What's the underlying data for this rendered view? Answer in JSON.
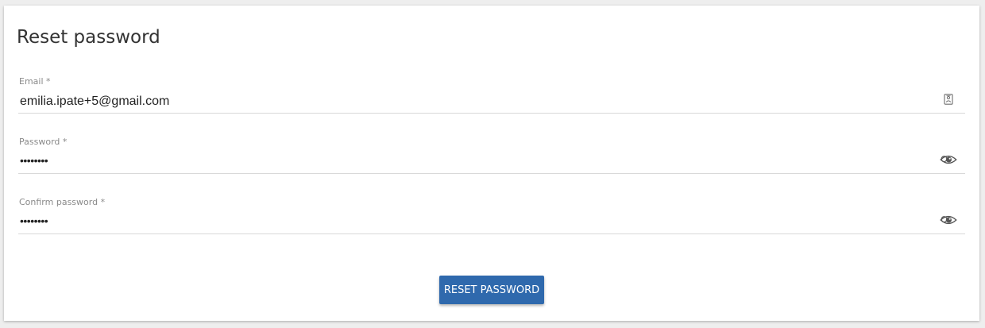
{
  "form": {
    "title": "Reset password",
    "fields": [
      {
        "label": "Email *",
        "value": "emilia.ipate+5@gmail.com",
        "icon": "contact-card-icon"
      },
      {
        "label": "Password *",
        "value": "••••••••",
        "icon": "eye-icon"
      },
      {
        "label": "Confirm password *",
        "value": "••••••••",
        "icon": "eye-icon"
      }
    ],
    "submit_label": "RESET PASSWORD"
  },
  "colors": {
    "button": "#2f69ad",
    "background": "#eeeeee",
    "card": "#ffffff"
  }
}
